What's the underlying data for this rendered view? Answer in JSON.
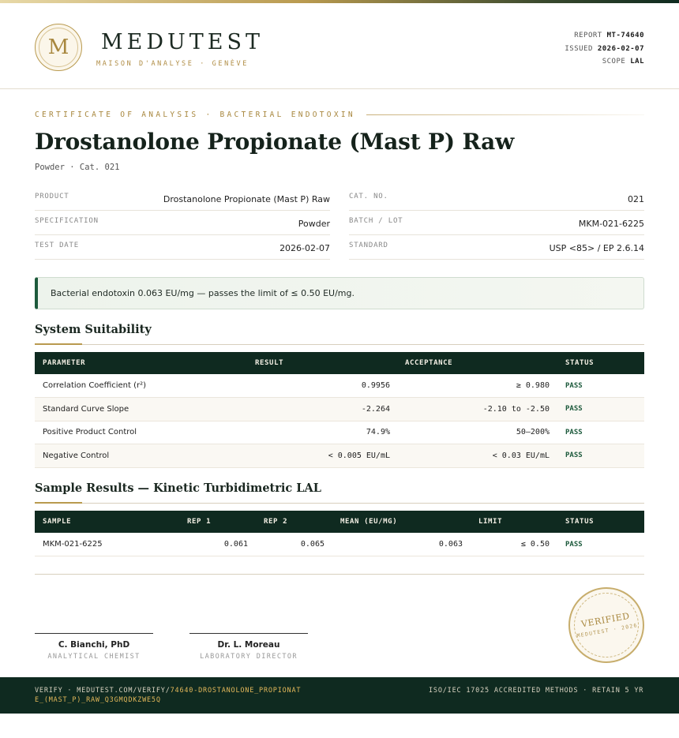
{
  "header": {
    "logo_letter": "M",
    "brand": "MEDUTEST",
    "tagline": "MAISON D'ANALYSE · GENÈVE",
    "report_label": "REPORT",
    "report_value": "MT-74640",
    "issued_label": "ISSUED",
    "issued_value": "2026-02-07",
    "scope_label": "SCOPE",
    "scope_value": "LAL"
  },
  "certificate": {
    "eyebrow": "CERTIFICATE OF ANALYSIS · BACTERIAL ENDOTOXIN",
    "title": "Drostanolone Propionate (Mast P) Raw",
    "subtitle": "Powder · Cat. 021"
  },
  "info": {
    "left": [
      {
        "label": "PRODUCT",
        "value": "Drostanolone Propionate (Mast P) Raw"
      },
      {
        "label": "SPECIFICATION",
        "value": "Powder"
      },
      {
        "label": "TEST DATE",
        "value": "2026-02-07"
      }
    ],
    "right": [
      {
        "label": "CAT. NO.",
        "value": "021"
      },
      {
        "label": "BATCH / LOT",
        "value": "MKM-021-6225"
      },
      {
        "label": "STANDARD",
        "value": "USP <85> / EP 2.6.14"
      }
    ]
  },
  "result_banner": "Bacterial endotoxin 0.063 EU/mg — passes the limit of ≤ 0.50 EU/mg.",
  "suitability": {
    "title": "System Suitability",
    "headers": [
      "PARAMETER",
      "RESULT",
      "ACCEPTANCE",
      "STATUS"
    ],
    "rows": [
      {
        "parameter": "Correlation Coefficient (r²)",
        "result": "0.9956",
        "acceptance": "≥ 0.980",
        "status": "PASS"
      },
      {
        "parameter": "Standard Curve Slope",
        "result": "-2.264",
        "acceptance": "-2.10 to -2.50",
        "status": "PASS"
      },
      {
        "parameter": "Positive Product Control",
        "result": "74.9%",
        "acceptance": "50–200%",
        "status": "PASS"
      },
      {
        "parameter": "Negative Control",
        "result": "< 0.005 EU/mL",
        "acceptance": "< 0.03 EU/mL",
        "status": "PASS"
      }
    ]
  },
  "samples": {
    "title": "Sample Results — Kinetic Turbidimetric LAL",
    "headers": [
      "SAMPLE",
      "REP 1",
      "REP 2",
      "MEAN (EU/MG)",
      "LIMIT",
      "STATUS"
    ],
    "rows": [
      {
        "sample": "MKM-021-6225",
        "rep1": "0.061",
        "rep2": "0.065",
        "mean": "0.063",
        "limit": "≤ 0.50",
        "status": "PASS"
      }
    ]
  },
  "signatures": [
    {
      "name": "C. Bianchi, PhD",
      "role": "ANALYTICAL CHEMIST"
    },
    {
      "name": "Dr. L. Moreau",
      "role": "LABORATORY DIRECTOR"
    }
  ],
  "stamp": {
    "main": "VERIFIED",
    "sub": "MEDUTEST · 2026"
  },
  "footer": {
    "verify_prefix": "VERIFY · MEDUTEST.COM/VERIFY/",
    "verify_code": "74640-DROSTANOLONE_PROPIONATE_(MAST_P)_RAW_Q3GMQDKZWE5Q",
    "accreditation": "ISO/IEC 17025 ACCREDITED METHODS · RETAIN 5 YR"
  }
}
